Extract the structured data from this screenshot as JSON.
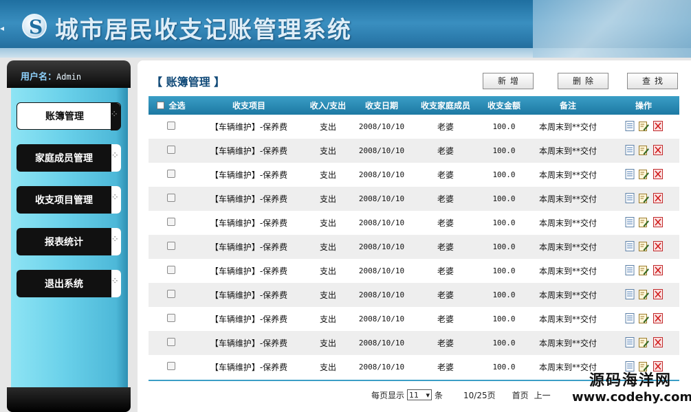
{
  "app": {
    "title": "城市居民收支记账管理系统"
  },
  "sidebar": {
    "user_label": "用户名：",
    "user_name": "Admin",
    "items": [
      {
        "label": "账簿管理",
        "active": true
      },
      {
        "label": "家庭成员管理",
        "active": false
      },
      {
        "label": "收支项目管理",
        "active": false
      },
      {
        "label": "报表统计",
        "active": false
      },
      {
        "label": "退出系统",
        "active": false
      }
    ]
  },
  "main": {
    "title": "【 账簿管理 】",
    "buttons": {
      "add": "新增",
      "delete": "删除",
      "search": "查找"
    }
  },
  "table": {
    "select_all": "全选",
    "columns": [
      "收支项目",
      "收入/支出",
      "收支日期",
      "收支家庭成员",
      "收支金额",
      "备注",
      "操作"
    ],
    "rows": [
      {
        "item": "【车辆维护】-保养费",
        "type": "支出",
        "date": "2008/10/10",
        "member": "老婆",
        "amount": "100.0",
        "note": "本周末到**交付"
      },
      {
        "item": "【车辆维护】-保养费",
        "type": "支出",
        "date": "2008/10/10",
        "member": "老婆",
        "amount": "100.0",
        "note": "本周末到**交付"
      },
      {
        "item": "【车辆维护】-保养费",
        "type": "支出",
        "date": "2008/10/10",
        "member": "老婆",
        "amount": "100.0",
        "note": "本周末到**交付"
      },
      {
        "item": "【车辆维护】-保养费",
        "type": "支出",
        "date": "2008/10/10",
        "member": "老婆",
        "amount": "100.0",
        "note": "本周末到**交付"
      },
      {
        "item": "【车辆维护】-保养费",
        "type": "支出",
        "date": "2008/10/10",
        "member": "老婆",
        "amount": "100.0",
        "note": "本周末到**交付"
      },
      {
        "item": "【车辆维护】-保养费",
        "type": "支出",
        "date": "2008/10/10",
        "member": "老婆",
        "amount": "100.0",
        "note": "本周末到**交付"
      },
      {
        "item": "【车辆维护】-保养费",
        "type": "支出",
        "date": "2008/10/10",
        "member": "老婆",
        "amount": "100.0",
        "note": "本周末到**交付"
      },
      {
        "item": "【车辆维护】-保养费",
        "type": "支出",
        "date": "2008/10/10",
        "member": "老婆",
        "amount": "100.0",
        "note": "本周末到**交付"
      },
      {
        "item": "【车辆维护】-保养费",
        "type": "支出",
        "date": "2008/10/10",
        "member": "老婆",
        "amount": "100.0",
        "note": "本周末到**交付"
      },
      {
        "item": "【车辆维护】-保养费",
        "type": "支出",
        "date": "2008/10/10",
        "member": "老婆",
        "amount": "100.0",
        "note": "本周末到**交付"
      },
      {
        "item": "【车辆维护】-保养费",
        "type": "支出",
        "date": "2008/10/10",
        "member": "老婆",
        "amount": "100.0",
        "note": "本周末到**交付"
      }
    ],
    "action_icons": [
      "view-icon",
      "edit-icon",
      "delete-icon"
    ]
  },
  "pager": {
    "per_page_label": "每页显示",
    "per_page_value": "11",
    "per_page_unit": "条",
    "page_info": "10/25页",
    "first": "首页",
    "prev": "上一"
  },
  "watermark": {
    "line1": "源码海洋网",
    "line2": "www.codehy.com"
  },
  "colors": {
    "header": "#2a79aa",
    "table_header": "#2a8bb5",
    "sidebar": "#6ad1ea",
    "title": "#114a78"
  }
}
